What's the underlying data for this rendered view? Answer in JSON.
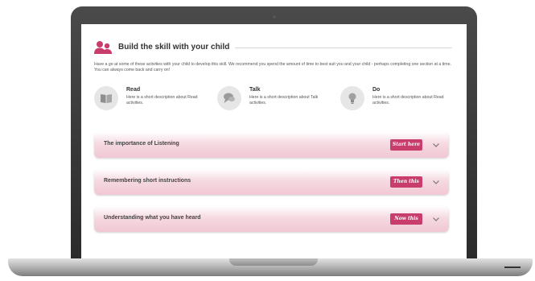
{
  "section": {
    "title": "Build the skill with your child",
    "intro": "Have a go at some of these activities with your child to develop this skill. We recommend you spend the amount of time to best suit you and your child - perhaps completing one section at a time. You can always come back and carry on!"
  },
  "activities": [
    {
      "title": "Read",
      "description": "Here is a short description about Read activities.",
      "icon": "book-icon"
    },
    {
      "title": "Talk",
      "description": "Here is a short description about Talk activities.",
      "icon": "speech-bubble-icon"
    },
    {
      "title": "Do",
      "description": "Here is a short description about Read activities.",
      "icon": "lightbulb-icon"
    }
  ],
  "accordion": [
    {
      "label": "The importance of Listening",
      "badge": "Start here"
    },
    {
      "label": "Remembering short instructions",
      "badge": "Then this"
    },
    {
      "label": "Understanding what you have heard",
      "badge": "Now this"
    }
  ],
  "colors": {
    "accent": "#c83d6b",
    "panel": "#f6d9e1",
    "frame": "#2a2a2a"
  }
}
